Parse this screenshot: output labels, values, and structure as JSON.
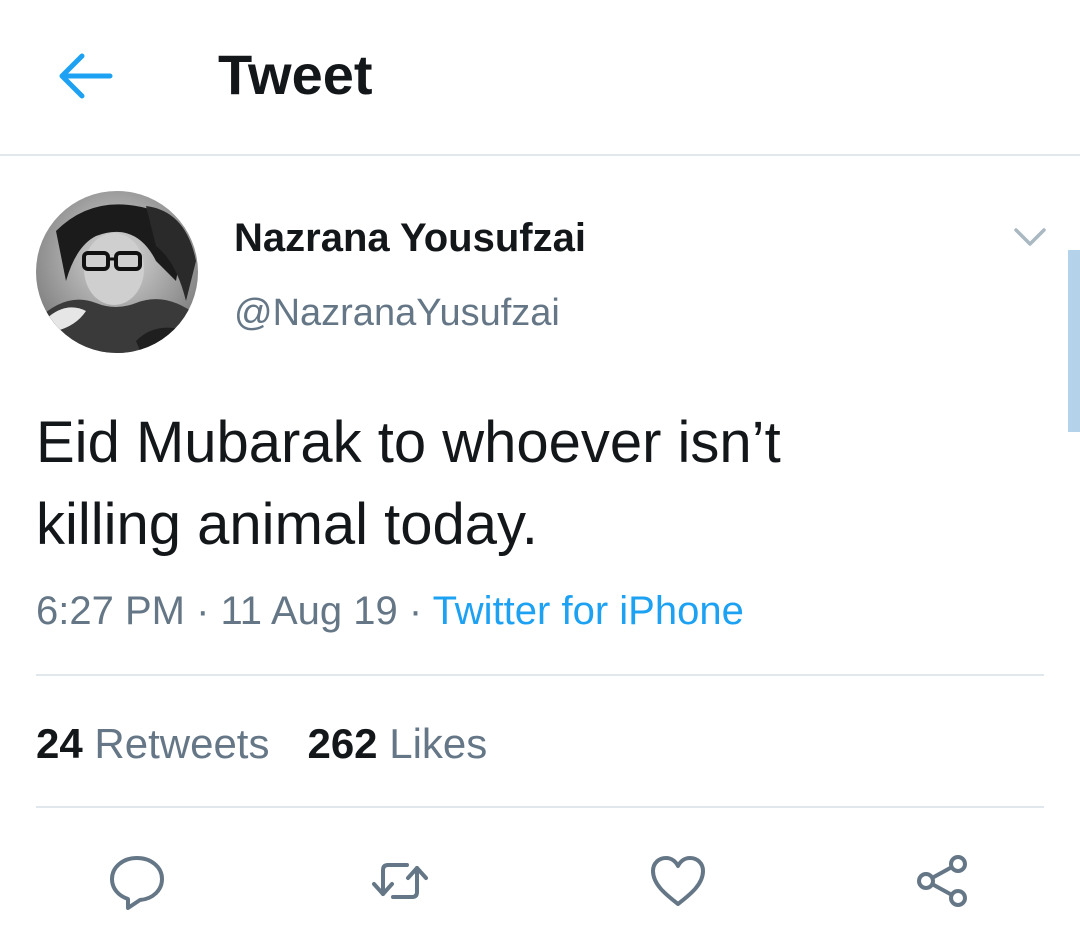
{
  "header": {
    "title": "Tweet",
    "back_icon": "arrow-left-icon",
    "accent_color": "#1da1f2"
  },
  "tweet": {
    "author": {
      "display_name": "Nazrana Yousufzai",
      "handle": "@NazranaYusufzai",
      "avatar": "avatar-photo"
    },
    "text": "Eid Mubarak to whoever isn’t\nkilling animal today.",
    "time": "6:27 PM",
    "separator": " · ",
    "date": "11 Aug 19",
    "source": "Twitter for iPhone",
    "stats": {
      "retweets_count": "24",
      "retweets_label": "Retweets",
      "likes_count": "262",
      "likes_label": "Likes"
    }
  },
  "actions": [
    {
      "name": "reply",
      "icon": "speech-bubble-icon"
    },
    {
      "name": "retweet",
      "icon": "retweet-arrows-icon"
    },
    {
      "name": "like",
      "icon": "heart-icon"
    },
    {
      "name": "share",
      "icon": "share-nodes-icon"
    }
  ],
  "colors": {
    "text_primary": "#14171a",
    "text_secondary": "#657786",
    "link": "#1da1f2",
    "divider": "#e1e8ed"
  }
}
